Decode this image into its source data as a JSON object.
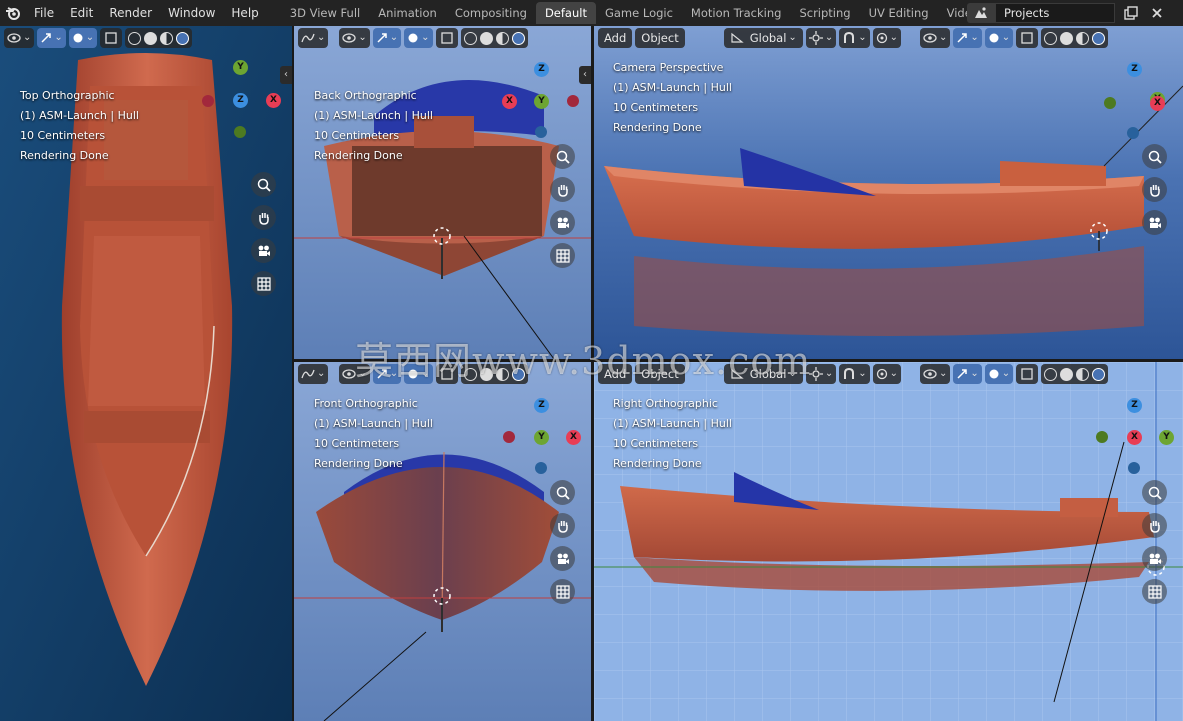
{
  "menu": [
    "File",
    "Edit",
    "Render",
    "Window",
    "Help"
  ],
  "workspaces": [
    {
      "label": "3D View Full",
      "active": false
    },
    {
      "label": "Animation",
      "active": false
    },
    {
      "label": "Compositing",
      "active": false
    },
    {
      "label": "Default",
      "active": true
    },
    {
      "label": "Game Logic",
      "active": false
    },
    {
      "label": "Motion Tracking",
      "active": false
    },
    {
      "label": "Scripting",
      "active": false
    },
    {
      "label": "UV Editing",
      "active": false
    },
    {
      "label": "Video Editing",
      "active": false
    }
  ],
  "add_workspace": "+",
  "scene": {
    "value": "Projects"
  },
  "header": {
    "add_label": "Add",
    "object_label": "Object",
    "orientation": "Global"
  },
  "viewports": {
    "top": {
      "view": "Top Orthographic",
      "object": "(1) ASM-Launch | Hull",
      "scale": "10 Centimeters",
      "status": "Rendering Done"
    },
    "back": {
      "view": "Back Orthographic",
      "object": "(1) ASM-Launch | Hull",
      "scale": "10 Centimeters",
      "status": "Rendering Done"
    },
    "camera": {
      "view": "Camera Perspective",
      "object": "(1) ASM-Launch | Hull",
      "scale": "10 Centimeters",
      "status": "Rendering Done"
    },
    "front": {
      "view": "Front Orthographic",
      "object": "(1) ASM-Launch | Hull",
      "scale": "10 Centimeters",
      "status": "Rendering Done"
    },
    "right": {
      "view": "Right Orthographic",
      "object": "(1) ASM-Launch | Hull",
      "scale": "10 Centimeters",
      "status": "Rendering Done"
    }
  },
  "axes": {
    "x": "X",
    "y": "Y",
    "z": "Z"
  },
  "watermark": "莫西网www.3dmox.com",
  "colors": {
    "hull": "#c85a40",
    "sea": "#1c4f7a",
    "canopy": "#2a3fb0",
    "accent": "#4772b3"
  }
}
